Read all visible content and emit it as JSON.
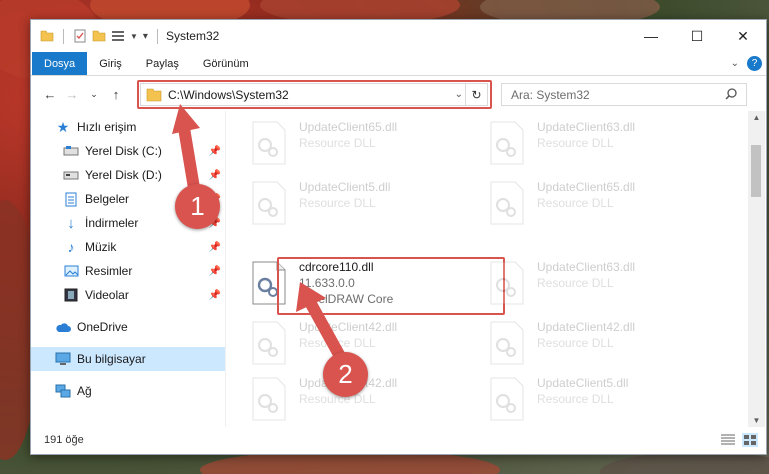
{
  "window": {
    "title": "System32",
    "controls": [
      "minimize-icon",
      "maximize-icon",
      "close-icon"
    ]
  },
  "ribbon": {
    "tabs": [
      "Dosya",
      "Giriş",
      "Paylaş",
      "Görünüm"
    ],
    "accent": "#1979ca"
  },
  "address": {
    "path": "C:\\Windows\\System32",
    "search_placeholder": "Ara: System32"
  },
  "sidebar": {
    "items": [
      {
        "label": "Hızlı erişim",
        "icon": "star-icon",
        "pinned": false
      },
      {
        "label": "Yerel Disk (C:)",
        "icon": "drive-icon",
        "pinned": true
      },
      {
        "label": "Yerel Disk (D:)",
        "icon": "drive-icon",
        "pinned": true
      },
      {
        "label": "Belgeler",
        "icon": "document-icon",
        "pinned": true
      },
      {
        "label": "İndirmeler",
        "icon": "download-icon",
        "pinned": true
      },
      {
        "label": "Müzik",
        "icon": "music-icon",
        "pinned": true
      },
      {
        "label": "Resimler",
        "icon": "pictures-icon",
        "pinned": true
      },
      {
        "label": "Videolar",
        "icon": "video-icon",
        "pinned": true
      },
      {
        "label": "OneDrive",
        "icon": "cloud-icon",
        "pinned": false
      },
      {
        "label": "Bu bilgisayar",
        "icon": "computer-icon",
        "pinned": false,
        "selected": true
      },
      {
        "label": "Ağ",
        "icon": "network-icon",
        "pinned": false
      }
    ]
  },
  "files": [
    {
      "name": "UpdateClient65.dll",
      "desc": "Resource DLL",
      "faded": true
    },
    {
      "name": "UpdateClient63.dll",
      "desc": "Resource DLL",
      "faded": true
    },
    {
      "name": "UpdateClient5.dll",
      "desc": "Resource DLL",
      "faded": true
    },
    {
      "name": "UpdateClient65.dll",
      "desc": "Resource DLL",
      "faded": true
    },
    {
      "name": "cdrcore110.dll",
      "version": "11.633.0.0",
      "desc": "CorelDRAW Core",
      "faded": false
    },
    {
      "name": "UpdateClient63.dll",
      "desc": "Resource DLL",
      "faded": true
    },
    {
      "name": "UpdateClient42.dll",
      "desc": "Resource DLL",
      "faded": true
    },
    {
      "name": "UpdateClient42.dll",
      "desc": "Resource DLL",
      "faded": true
    },
    {
      "name": "UpdateClient42.dll",
      "desc": "Resource DLL",
      "faded": true
    },
    {
      "name": "UpdateClient5.dll",
      "desc": "Resource DLL",
      "faded": true
    }
  ],
  "status": {
    "count": "191 öğe"
  },
  "annotations": {
    "step1": "1",
    "step2": "2",
    "color": "#d9534f"
  }
}
